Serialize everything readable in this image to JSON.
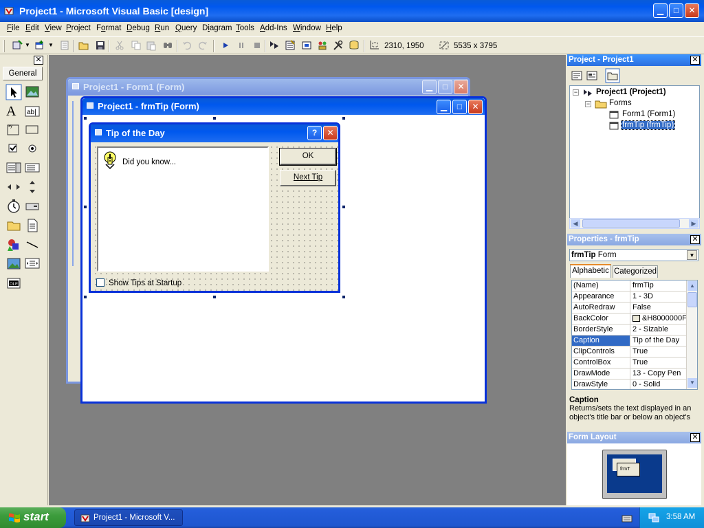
{
  "window": {
    "title": "Project1 - Microsoft Visual Basic [design]"
  },
  "menu": [
    {
      "label": "File",
      "accel": "F",
      "rest": "ile"
    },
    {
      "label": "Edit",
      "accel": "E",
      "rest": "dit"
    },
    {
      "label": "View",
      "accel": "V",
      "rest": "iew"
    },
    {
      "label": "Project",
      "accel": "P",
      "rest": "roject"
    },
    {
      "label": "Format",
      "accel": "o",
      "pre": "F",
      "rest": "rmat"
    },
    {
      "label": "Debug",
      "accel": "D",
      "rest": "ebug"
    },
    {
      "label": "Run",
      "accel": "R",
      "rest": "un"
    },
    {
      "label": "Query",
      "accel": "Q",
      "rest": "uery"
    },
    {
      "label": "Diagram",
      "accel": "i",
      "pre": "D",
      "rest": "agram"
    },
    {
      "label": "Tools",
      "accel": "T",
      "rest": "ools"
    },
    {
      "label": "Add-Ins",
      "accel": "A",
      "rest": "dd-Ins"
    },
    {
      "label": "Window",
      "accel": "W",
      "rest": "indow"
    },
    {
      "label": "Help",
      "accel": "H",
      "rest": "elp"
    }
  ],
  "toolbar": {
    "position_readout": "2310, 1950",
    "size_readout": "5535 x 3795"
  },
  "toolbox": {
    "tab_label": "General",
    "close_glyph": "✕"
  },
  "forms": {
    "form1_title": "Project1 - Form1 (Form)",
    "frmtip_title": "Project1 - frmTip (Form)"
  },
  "tip_dialog": {
    "title": "Tip of the Day",
    "did_you_know": "Did you know...",
    "ok_label": "OK",
    "next_tip_label": "Next Tip",
    "show_tips_label": "Show Tips at Startup",
    "help_glyph": "?",
    "close_glyph": "✕"
  },
  "project_panel": {
    "title": "Project - Project1",
    "tree": {
      "root": "Project1 (Project1)",
      "folder": "Forms",
      "items": [
        "Form1 (Form1)",
        "frmTip (frmTip)"
      ]
    }
  },
  "properties_panel": {
    "title": "Properties - frmTip",
    "object_name": "frmTip",
    "object_type": "Form",
    "tabs": [
      "Alphabetic",
      "Categorized"
    ],
    "rows": [
      {
        "name": "(Name)",
        "value": "frmTip"
      },
      {
        "name": "Appearance",
        "value": "1 - 3D"
      },
      {
        "name": "AutoRedraw",
        "value": "False"
      },
      {
        "name": "BackColor",
        "value": "&H8000000F"
      },
      {
        "name": "BorderStyle",
        "value": "2 - Sizable"
      },
      {
        "name": "Caption",
        "value": "Tip of the Day"
      },
      {
        "name": "ClipControls",
        "value": "True"
      },
      {
        "name": "ControlBox",
        "value": "True"
      },
      {
        "name": "DrawMode",
        "value": "13 - Copy Pen"
      },
      {
        "name": "DrawStyle",
        "value": "0 - Solid"
      }
    ],
    "desc_title": "Caption",
    "desc_text": "Returns/sets the text displayed in an object's title bar or below an object's"
  },
  "form_layout": {
    "title": "Form Layout",
    "thumb_label": "frmT"
  },
  "taskbar": {
    "start_label": "start",
    "task_label": "Project1 - Microsoft V...",
    "clock": "3:58 AM"
  },
  "colors": {
    "xp_blue": "#0058ee",
    "mdi_gray": "#808080",
    "selected_row": "#316ac5",
    "start_green": "#3c9c3c"
  }
}
